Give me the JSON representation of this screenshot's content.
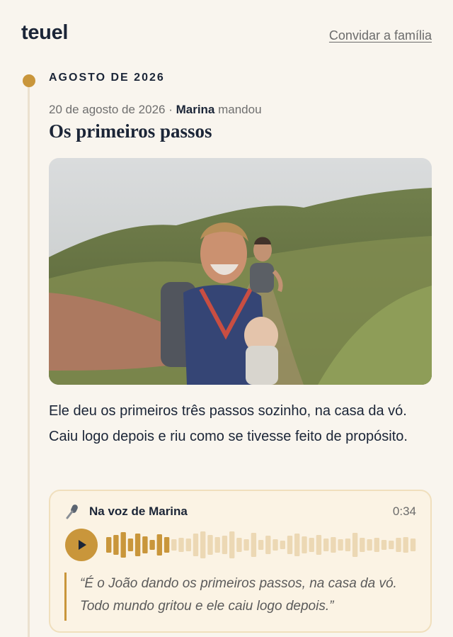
{
  "app": {
    "logo": "teuel",
    "invite_link": "Convidar a família"
  },
  "timeline": {
    "month_label": "AGOSTO DE 2026",
    "entry": {
      "date": "20 de agosto de 2026",
      "separator": " · ",
      "sender": "Marina",
      "action": " mandou",
      "title": "Os primeiros passos",
      "photo_alt": "Selfie em trilha com bebê no carregador",
      "text": "Ele deu os primeiros três passos sozinho, na casa da vó. Caiu logo depois e riu como se tivesse feito de propósito.",
      "audio": {
        "label": "Na voz de Marina",
        "duration": "0:34",
        "progress": 0.22,
        "waveform": [
          0.55,
          0.7,
          0.9,
          0.45,
          0.8,
          0.6,
          0.35,
          0.75,
          0.55,
          0.4,
          0.5,
          0.45,
          0.8,
          0.95,
          0.7,
          0.55,
          0.65,
          0.95,
          0.5,
          0.4,
          0.85,
          0.35,
          0.65,
          0.4,
          0.3,
          0.65,
          0.8,
          0.6,
          0.5,
          0.7,
          0.45,
          0.55,
          0.4,
          0.45,
          0.85,
          0.5,
          0.4,
          0.5,
          0.35,
          0.3,
          0.5,
          0.55,
          0.45
        ],
        "transcript": "“É o João dando os primeiros passos, na casa da vó. Todo mundo gritou e ele caiu logo depois.”"
      }
    }
  },
  "colors": {
    "background": "#f9f5ee",
    "accent": "#c9963b",
    "wave_played": "#c9963b",
    "wave_unplayed": "#ecd8b4",
    "text": "#1b2537"
  },
  "icons": {
    "mic": "microphone-icon",
    "play": "play-icon"
  }
}
